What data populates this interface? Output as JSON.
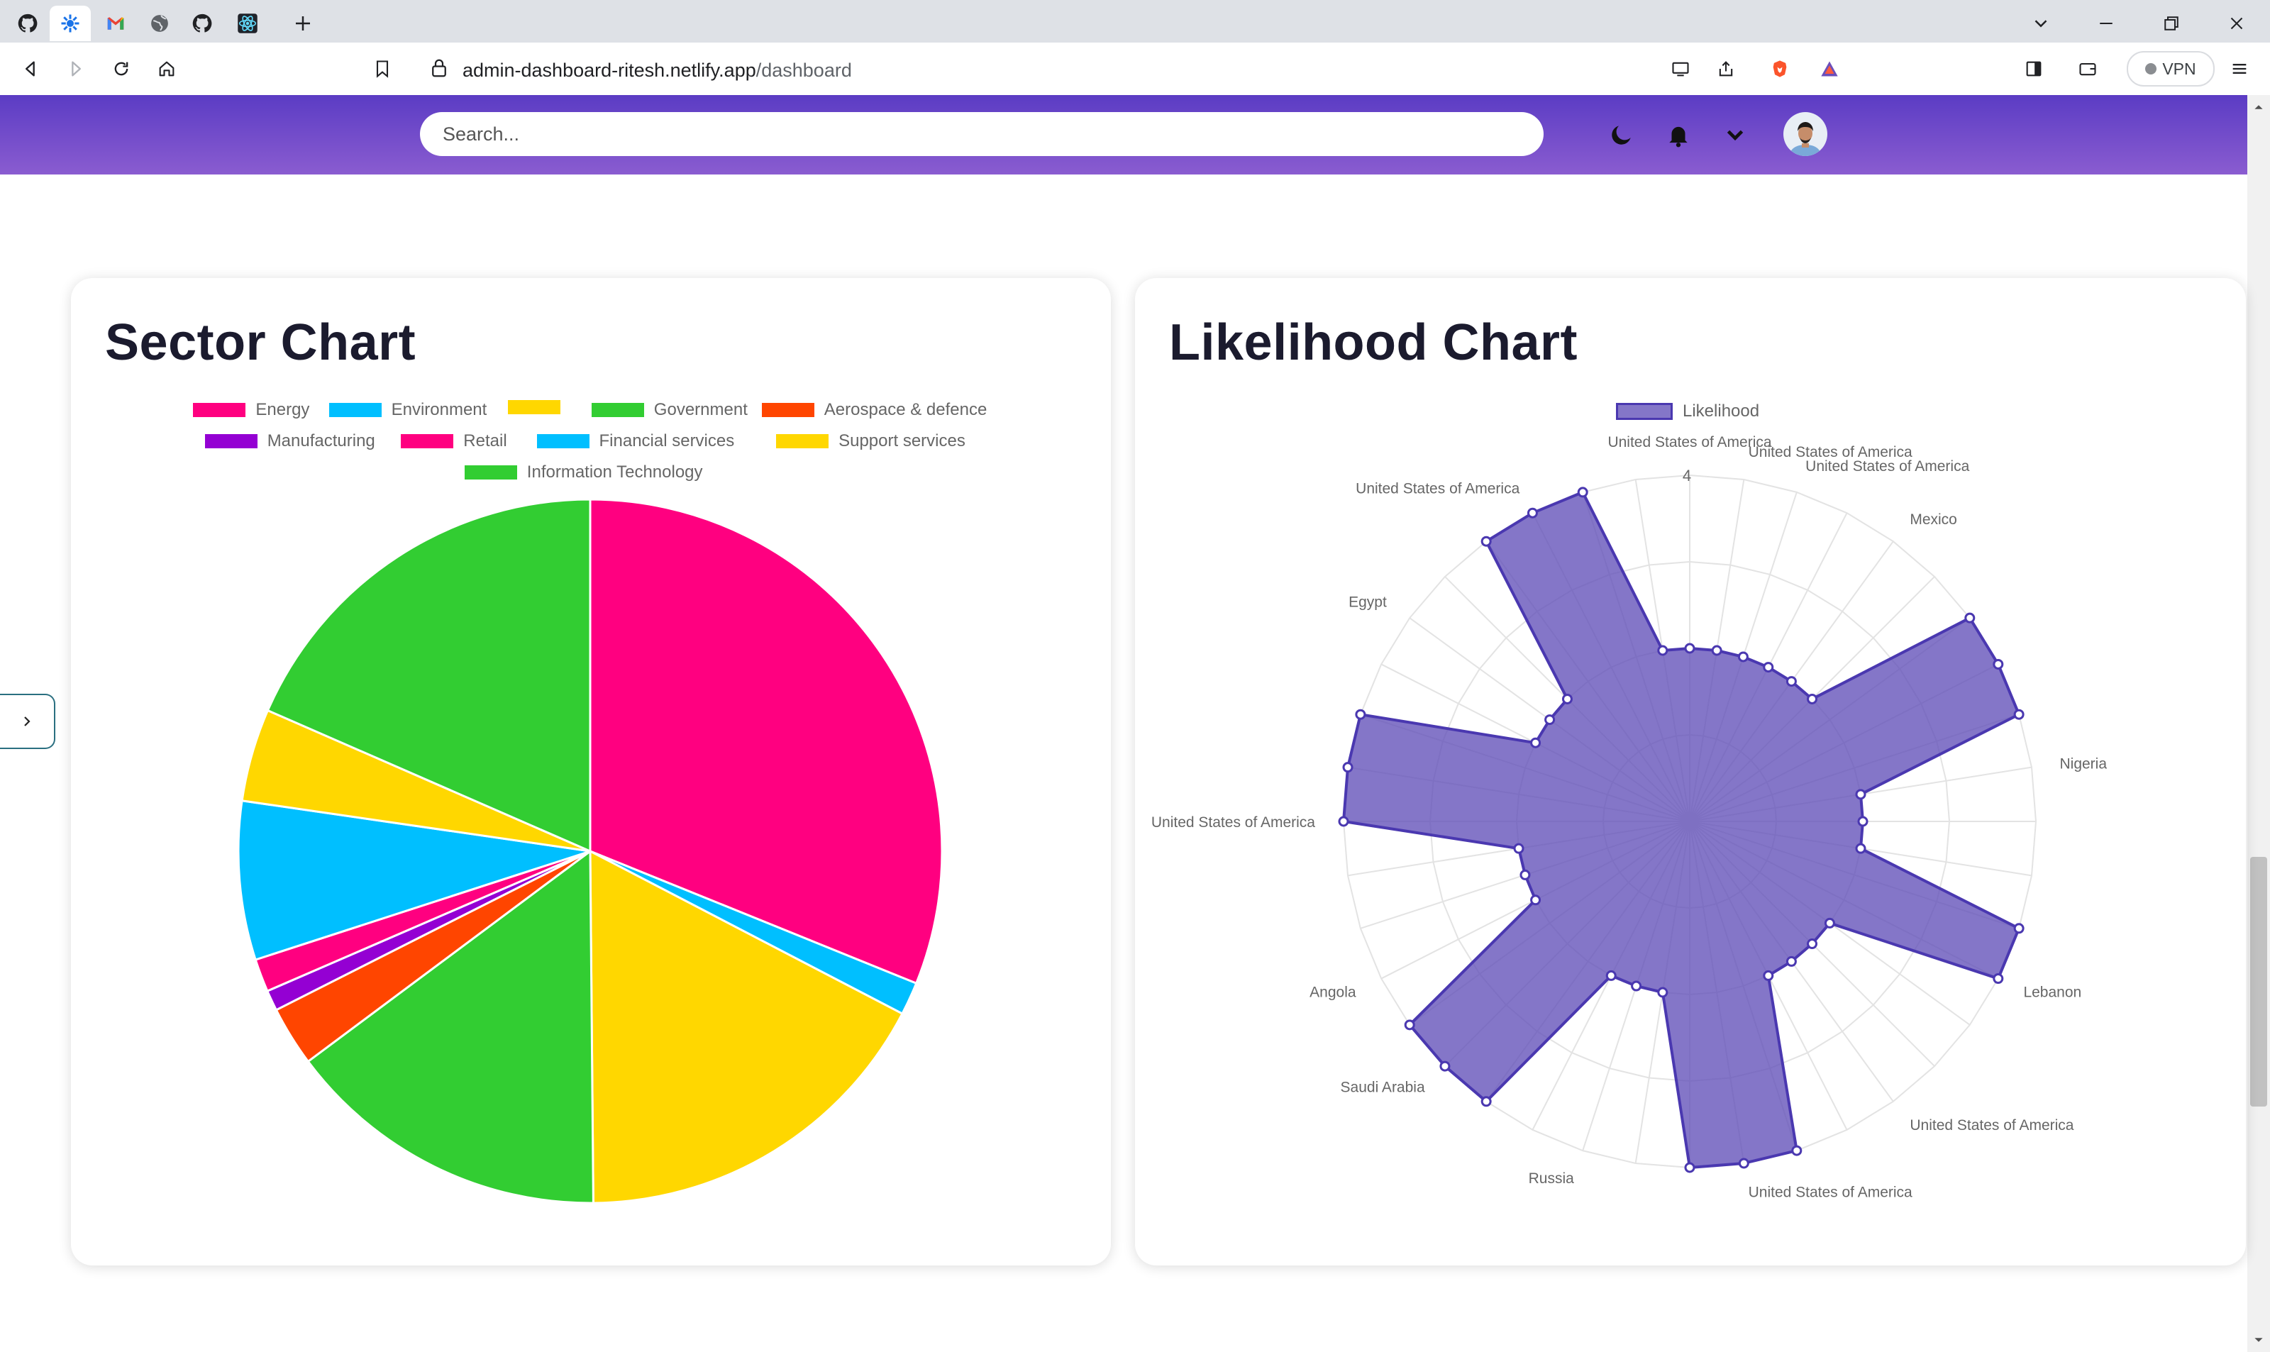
{
  "browser": {
    "tabs": [
      {
        "icon": "github-icon",
        "active": false
      },
      {
        "icon": "app-logo-icon",
        "active": true
      },
      {
        "icon": "gmail-icon",
        "active": false
      },
      {
        "icon": "globe-icon",
        "active": false
      },
      {
        "icon": "github-icon",
        "active": false
      },
      {
        "icon": "react-icon",
        "active": false
      }
    ],
    "url_host": "admin-dashboard-ritesh.netlify.app",
    "url_path": "/dashboard",
    "vpn_label": "VPN"
  },
  "header": {
    "search_placeholder": "Search..."
  },
  "colors": {
    "header_gradient": [
      "#5b3cc4",
      "#8a5cd0"
    ],
    "radar_fill": "rgba(98, 79, 185, 0.78)",
    "radar_stroke": "#4a38b0"
  },
  "sector_card": {
    "title": "Sector Chart",
    "legend": [
      {
        "label": "Energy",
        "color": "#ff0080"
      },
      {
        "label": "Environment",
        "color": "#00bfff"
      },
      {
        "label": "",
        "color": "#ffd700"
      },
      {
        "label": "Government",
        "color": "#32cd32"
      },
      {
        "label": "Aerospace & defence",
        "color": "#ff4500"
      },
      {
        "label": "Manufacturing",
        "color": "#9400d3"
      },
      {
        "label": "Retail",
        "color": "#ff0080"
      },
      {
        "label": "Financial services",
        "color": "#00bfff"
      },
      {
        "label": "Support services",
        "color": "#ffd700"
      },
      {
        "label": "Information Technology",
        "color": "#32cd32"
      }
    ]
  },
  "likelihood_card": {
    "title": "Likelihood Chart",
    "legend_label": "Likelihood"
  },
  "chart_data": [
    {
      "type": "pie",
      "title": "Sector Chart",
      "categories": [
        "Energy",
        "Environment",
        "",
        "Government",
        "Aerospace & defence",
        "Manufacturing",
        "Retail",
        "Financial services",
        "Support services",
        "Information Technology"
      ],
      "values": [
        32.9,
        1.6,
        18.2,
        15.8,
        2.9,
        1.0,
        1.6,
        7.7,
        4.5,
        19.5
      ],
      "colors": [
        "#ff0080",
        "#00bfff",
        "#ffd700",
        "#32cd32",
        "#ff4500",
        "#9400d3",
        "#ff0080",
        "#00bfff",
        "#ffd700",
        "#32cd32"
      ],
      "legend": "top"
    },
    {
      "type": "radar",
      "title": "Likelihood Chart",
      "series": [
        {
          "name": "Likelihood",
          "values": [
            2,
            2,
            2,
            2,
            2,
            2,
            4,
            4,
            4,
            2,
            2,
            2,
            4,
            4,
            2,
            2,
            2,
            2,
            4,
            4,
            4,
            2,
            2,
            2,
            4,
            4,
            4,
            2,
            2,
            2,
            4,
            4,
            4,
            2,
            2,
            2,
            4,
            4,
            4,
            2
          ]
        }
      ],
      "point_labels": [
        "United States of America",
        "United States of America",
        "United States of America",
        "Mexico",
        "Nigeria",
        "Lebanon",
        "United States of America",
        "United States of America",
        "Russia",
        "Saudi Arabia",
        "Angola",
        "United States of America",
        "Egypt",
        "United States of America"
      ],
      "r_max": 4,
      "r_tick": "4",
      "grid": true,
      "legend": "top"
    }
  ]
}
